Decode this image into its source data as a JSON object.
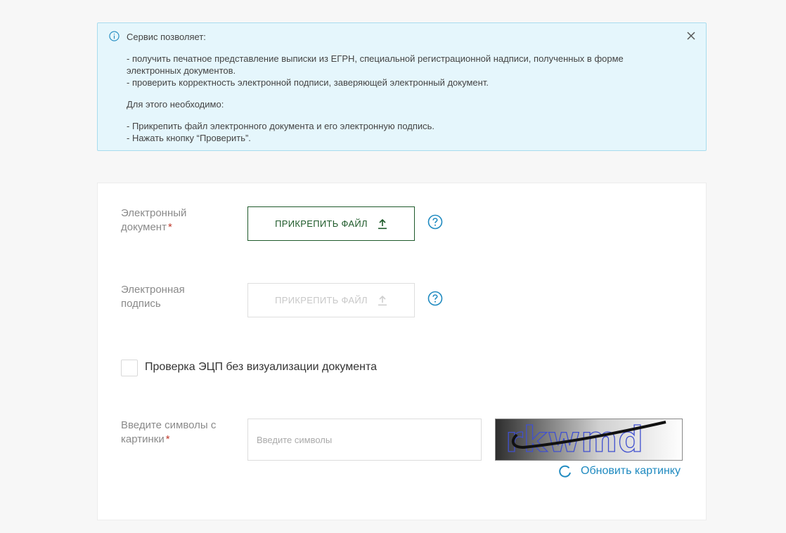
{
  "info": {
    "heading": "Сервис позволяет:",
    "line1": "- получить печатное представление выписки из ЕГРН, специальной регистрационной надписи, полученных в форме электронных документов.",
    "line2": "- проверить корректность электронной подписи, заверяющей электронный документ.",
    "subheading": "Для этого необходимо:",
    "step1": "- Прикрепить файл электронного документа и его электронную подпись.",
    "step2": "- Нажать кнопку “Проверить”."
  },
  "form": {
    "doc_label_line1": "Электронный",
    "doc_label_line2": "документ",
    "doc_required": "*",
    "doc_button": "ПРИКРЕПИТЬ ФАЙЛ",
    "sig_label_line1": "Электронная",
    "sig_label_line2": "подпись",
    "sig_button": "ПРИКРЕПИТЬ ФАЙЛ",
    "checkbox_label": "Проверка ЭЦП без визуализации документа",
    "captcha_label_line1": "Введите символы с",
    "captcha_label_line2": "картинки",
    "captcha_required": "*",
    "captcha_placeholder": "Введите символы",
    "captcha_value": "",
    "captcha_text": "rkwmd",
    "refresh_label": "Обновить картинку"
  },
  "colors": {
    "accent_green": "#1e5a2a",
    "link_blue": "#1f8ac0",
    "info_bg": "#e5f6fc",
    "required": "#c0392b"
  },
  "icons": {
    "info": "info-circle-icon",
    "close": "close-icon",
    "upload": "upload-arrow-icon",
    "help": "question-circle-icon",
    "refresh": "refresh-icon"
  }
}
